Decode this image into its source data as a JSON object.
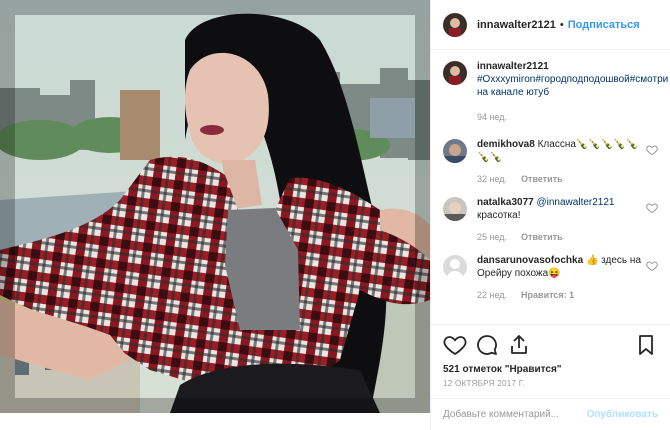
{
  "header": {
    "username": "innawalter2121",
    "separator": "•",
    "follow_label": "Подписаться"
  },
  "caption": {
    "username": "innawalter2121",
    "text": "#Oxxxymiron#городподподошвой#смотри на канале ютуб",
    "age": "94 нед."
  },
  "comments": [
    {
      "username": "demikhova8",
      "text": "Классна🍾🍾🍾🍾🍾🍾🍾",
      "age": "32 нед.",
      "reply": "Ответить",
      "likes": ""
    },
    {
      "username": "natalka3077",
      "mention": "@innawalter2121",
      "text": "красотка!",
      "age": "25 нед.",
      "reply": "Ответить",
      "likes": ""
    },
    {
      "username": "dansarunovasofochka",
      "text": "👍 здесь на Орейру похожа😝",
      "age": "22 нед.",
      "reply": "",
      "likes": "Нравится: 1"
    }
  ],
  "likes": "521 отметок \"Нравится\"",
  "date": "12 ОКТЯБРЯ 2017 Г.",
  "add_comment": {
    "placeholder": "Добавьте комментарий...",
    "publish_label": "Опубликовать"
  },
  "icons": {
    "like": "heart-icon",
    "comment": "comment-icon",
    "share": "share-icon",
    "save": "bookmark-icon"
  },
  "colors": {
    "link": "#3897f0",
    "hashtag": "#003569",
    "muted": "#999999",
    "publish_disabled": "#b2dffc"
  }
}
